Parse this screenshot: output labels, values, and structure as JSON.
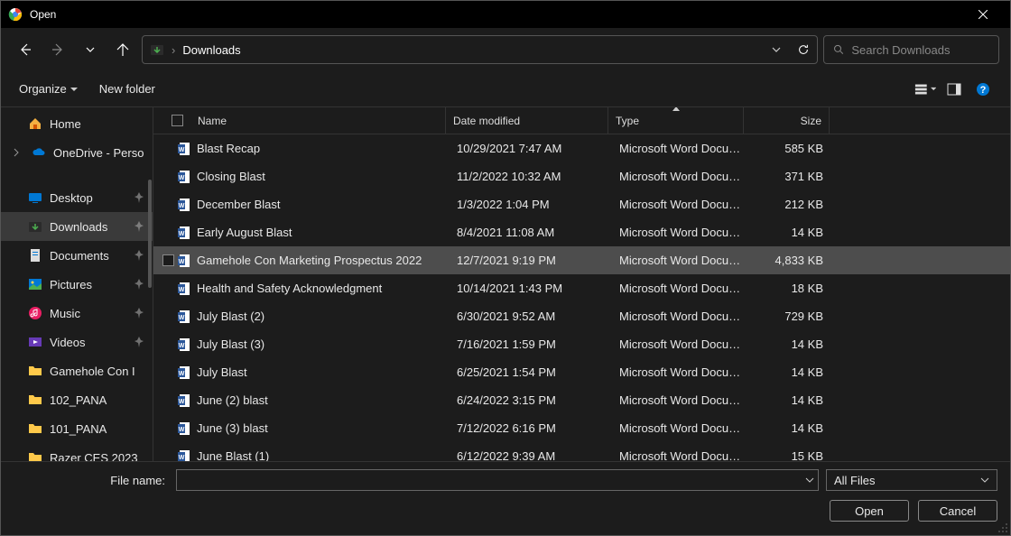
{
  "title": "Open",
  "breadcrumb": "Downloads",
  "search_placeholder": "Search Downloads",
  "toolbar": {
    "organize": "Organize",
    "newfolder": "New folder"
  },
  "sidebar": {
    "home": "Home",
    "onedrive": "OneDrive - Perso",
    "items": [
      {
        "label": "Desktop"
      },
      {
        "label": "Downloads"
      },
      {
        "label": "Documents"
      },
      {
        "label": "Pictures"
      },
      {
        "label": "Music"
      },
      {
        "label": "Videos"
      },
      {
        "label": "Gamehole Con I"
      },
      {
        "label": "102_PANA"
      },
      {
        "label": "101_PANA"
      },
      {
        "label": "Razer CES 2023"
      }
    ]
  },
  "columns": {
    "name": "Name",
    "date": "Date modified",
    "type": "Type",
    "size": "Size"
  },
  "files": [
    {
      "name": "Blast Recap",
      "date": "10/29/2021 7:47 AM",
      "type": "Microsoft Word Docum...",
      "size": "585 KB"
    },
    {
      "name": "Closing Blast",
      "date": "11/2/2022 10:32 AM",
      "type": "Microsoft Word Docum...",
      "size": "371 KB"
    },
    {
      "name": "December Blast",
      "date": "1/3/2022 1:04 PM",
      "type": "Microsoft Word Docum...",
      "size": "212 KB"
    },
    {
      "name": "Early August Blast",
      "date": "8/4/2021 11:08 AM",
      "type": "Microsoft Word Docum...",
      "size": "14 KB"
    },
    {
      "name": "Gamehole Con Marketing Prospectus 2022",
      "date": "12/7/2021 9:19 PM",
      "type": "Microsoft Word Docum...",
      "size": "4,833 KB"
    },
    {
      "name": "Health and Safety Acknowledgment",
      "date": "10/14/2021 1:43 PM",
      "type": "Microsoft Word Docum...",
      "size": "18 KB"
    },
    {
      "name": "July Blast (2)",
      "date": "6/30/2021 9:52 AM",
      "type": "Microsoft Word Docum...",
      "size": "729 KB"
    },
    {
      "name": "July Blast (3)",
      "date": "7/16/2021 1:59 PM",
      "type": "Microsoft Word Docum...",
      "size": "14 KB"
    },
    {
      "name": "July Blast",
      "date": "6/25/2021 1:54 PM",
      "type": "Microsoft Word Docum...",
      "size": "14 KB"
    },
    {
      "name": "June (2) blast",
      "date": "6/24/2022 3:15 PM",
      "type": "Microsoft Word Docum...",
      "size": "14 KB"
    },
    {
      "name": "June (3) blast",
      "date": "7/12/2022 6:16 PM",
      "type": "Microsoft Word Docum...",
      "size": "14 KB"
    },
    {
      "name": "June Blast (1)",
      "date": "6/12/2022 9:39 AM",
      "type": "Microsoft Word Docum...",
      "size": "15 KB"
    }
  ],
  "selected_index": 4,
  "footer": {
    "filename_label": "File name:",
    "filename_value": "",
    "filter": "All Files",
    "open": "Open",
    "cancel": "Cancel"
  }
}
